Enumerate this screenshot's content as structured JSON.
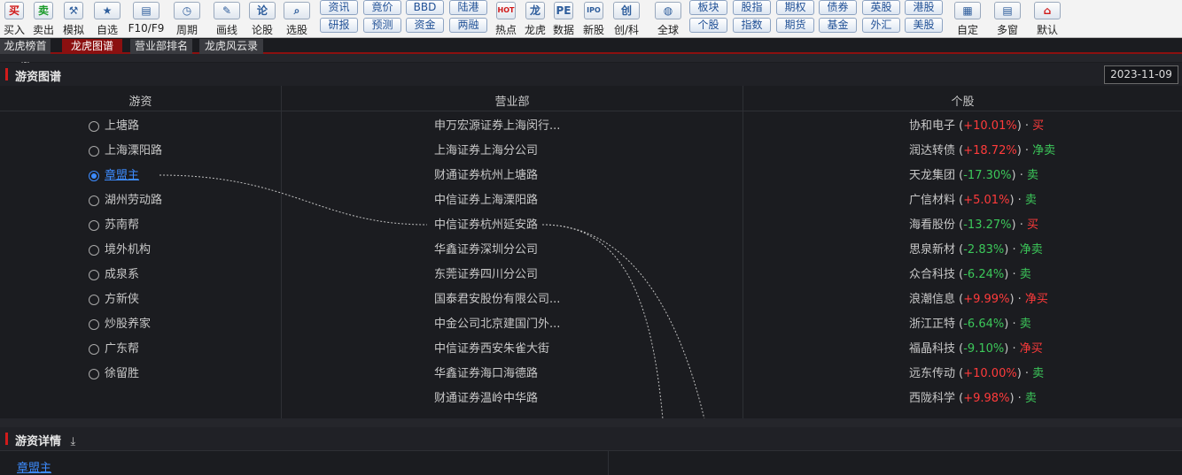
{
  "toolbar": {
    "big_buttons": [
      {
        "label": "买入",
        "icon": "buy-icon",
        "glyph": "买"
      },
      {
        "label": "卖出",
        "icon": "sell-icon",
        "glyph": "卖"
      },
      {
        "label": "模拟",
        "icon": "hammer-icon",
        "glyph": "⚒"
      },
      {
        "label": "自选",
        "icon": "star-icon",
        "glyph": "★"
      },
      {
        "label": "F10/F9",
        "icon": "f10-icon",
        "glyph": "▤"
      },
      {
        "label": "周期",
        "icon": "clock-icon",
        "glyph": "◷"
      },
      {
        "label": "画线",
        "icon": "pen-icon",
        "glyph": "✎"
      },
      {
        "label": "论股",
        "icon": "discuss-icon",
        "glyph": "论"
      },
      {
        "label": "选股",
        "icon": "magnifier-icon",
        "glyph": "⌕"
      }
    ],
    "chips_col1": [
      "资讯",
      "研报"
    ],
    "chips_col2": [
      "竟价",
      "预测"
    ],
    "chips_col3": [
      "BBD",
      "资金"
    ],
    "chips_col4": [
      "陆港",
      "两融"
    ],
    "mid_buttons": [
      {
        "label": "热点",
        "icon": "hot-icon",
        "glyph": "HOT"
      },
      {
        "label": "龙虎",
        "icon": "dragon-icon",
        "glyph": "龙"
      },
      {
        "label": "数据",
        "icon": "pe-icon",
        "glyph": "PE"
      },
      {
        "label": "新股",
        "icon": "ipo-icon",
        "glyph": "IPO"
      },
      {
        "label": "创/科",
        "icon": "chuang-icon",
        "glyph": "创"
      },
      {
        "label": "全球",
        "icon": "globe-icon",
        "glyph": "◍"
      }
    ],
    "chips_col5": [
      "板块",
      "个股"
    ],
    "chips_col6": [
      "股指",
      "指数"
    ],
    "chips_col7": [
      "期权",
      "期货"
    ],
    "chips_col8": [
      "债券",
      "基金"
    ],
    "chips_col9": [
      "英股",
      "外汇"
    ],
    "chips_col10": [
      "港股",
      "美股"
    ],
    "end_buttons": [
      {
        "label": "自定",
        "icon": "custom-icon",
        "glyph": "▦"
      },
      {
        "label": "多窗",
        "icon": "multiwindow-icon",
        "glyph": "▤"
      },
      {
        "label": "默认",
        "icon": "home-icon",
        "glyph": "⌂"
      }
    ]
  },
  "tabs": [
    "龙虎榜首页",
    "龙虎图谱",
    "营业部排名",
    "龙虎风云录"
  ],
  "active_tab": "龙虎图谱",
  "graph_section": {
    "title": "游资图谱",
    "date": "2023-11-09",
    "columns": [
      "游资",
      "营业部",
      "个股"
    ]
  },
  "youzi": [
    {
      "name": "上塘路",
      "selected": false
    },
    {
      "name": "上海溧阳路",
      "selected": false
    },
    {
      "name": "章盟主",
      "selected": true
    },
    {
      "name": "湖州劳动路",
      "selected": false
    },
    {
      "name": "苏南帮",
      "selected": false
    },
    {
      "name": "境外机构",
      "selected": false
    },
    {
      "name": "成泉系",
      "selected": false
    },
    {
      "name": "方新侠",
      "selected": false
    },
    {
      "name": "炒股养家",
      "selected": false
    },
    {
      "name": "广东帮",
      "selected": false
    },
    {
      "name": "徐留胜",
      "selected": false
    }
  ],
  "branches": [
    "申万宏源证券上海闵行...",
    "上海证券上海分公司",
    "财通证券杭州上塘路",
    "中信证券上海溧阳路",
    "中信证券杭州延安路",
    "华鑫证券深圳分公司",
    "东莞证券四川分公司",
    "国泰君安股份有限公司...",
    "中金公司北京建国门外...",
    "中信证券西安朱雀大街",
    "华鑫证券海口海德路",
    "财通证券温岭中华路"
  ],
  "stocks": [
    {
      "name": "协和电子",
      "pct": "+10.01%",
      "dir": "up",
      "action": "买",
      "action_dir": "up"
    },
    {
      "name": "润达转债",
      "pct": "+18.72%",
      "dir": "up",
      "action": "净卖",
      "action_dir": "down"
    },
    {
      "name": "天龙集团",
      "pct": "-17.30%",
      "dir": "down",
      "action": "卖",
      "action_dir": "down"
    },
    {
      "name": "广信材料",
      "pct": "+5.01%",
      "dir": "up",
      "action": "卖",
      "action_dir": "down"
    },
    {
      "name": "海看股份",
      "pct": "-13.27%",
      "dir": "down",
      "action": "买",
      "action_dir": "up"
    },
    {
      "name": "思泉新材",
      "pct": "-2.83%",
      "dir": "down",
      "action": "净卖",
      "action_dir": "down"
    },
    {
      "name": "众合科技",
      "pct": "-6.24%",
      "dir": "down",
      "action": "卖",
      "action_dir": "down"
    },
    {
      "name": "浪潮信息",
      "pct": "+9.99%",
      "dir": "up",
      "action": "净买",
      "action_dir": "up"
    },
    {
      "name": "浙江正特",
      "pct": "-6.64%",
      "dir": "down",
      "action": "卖",
      "action_dir": "down"
    },
    {
      "name": "福晶科技",
      "pct": "-9.10%",
      "dir": "down",
      "action": "净买",
      "action_dir": "up"
    },
    {
      "name": "远东传动",
      "pct": "+10.00%",
      "dir": "up",
      "action": "卖",
      "action_dir": "down"
    },
    {
      "name": "西陇科学",
      "pct": "+9.98%",
      "dir": "up",
      "action": "卖",
      "action_dir": "down"
    }
  ],
  "detail_section": {
    "title": "游资详情",
    "selected_name": "章盟主",
    "download_icon": "download-icon"
  },
  "colors": {
    "accent_red": "#d11b1b",
    "up": "#ff3b3b",
    "down": "#3cc85a",
    "link_blue": "#3d8cff",
    "background": "#1b1c20"
  }
}
